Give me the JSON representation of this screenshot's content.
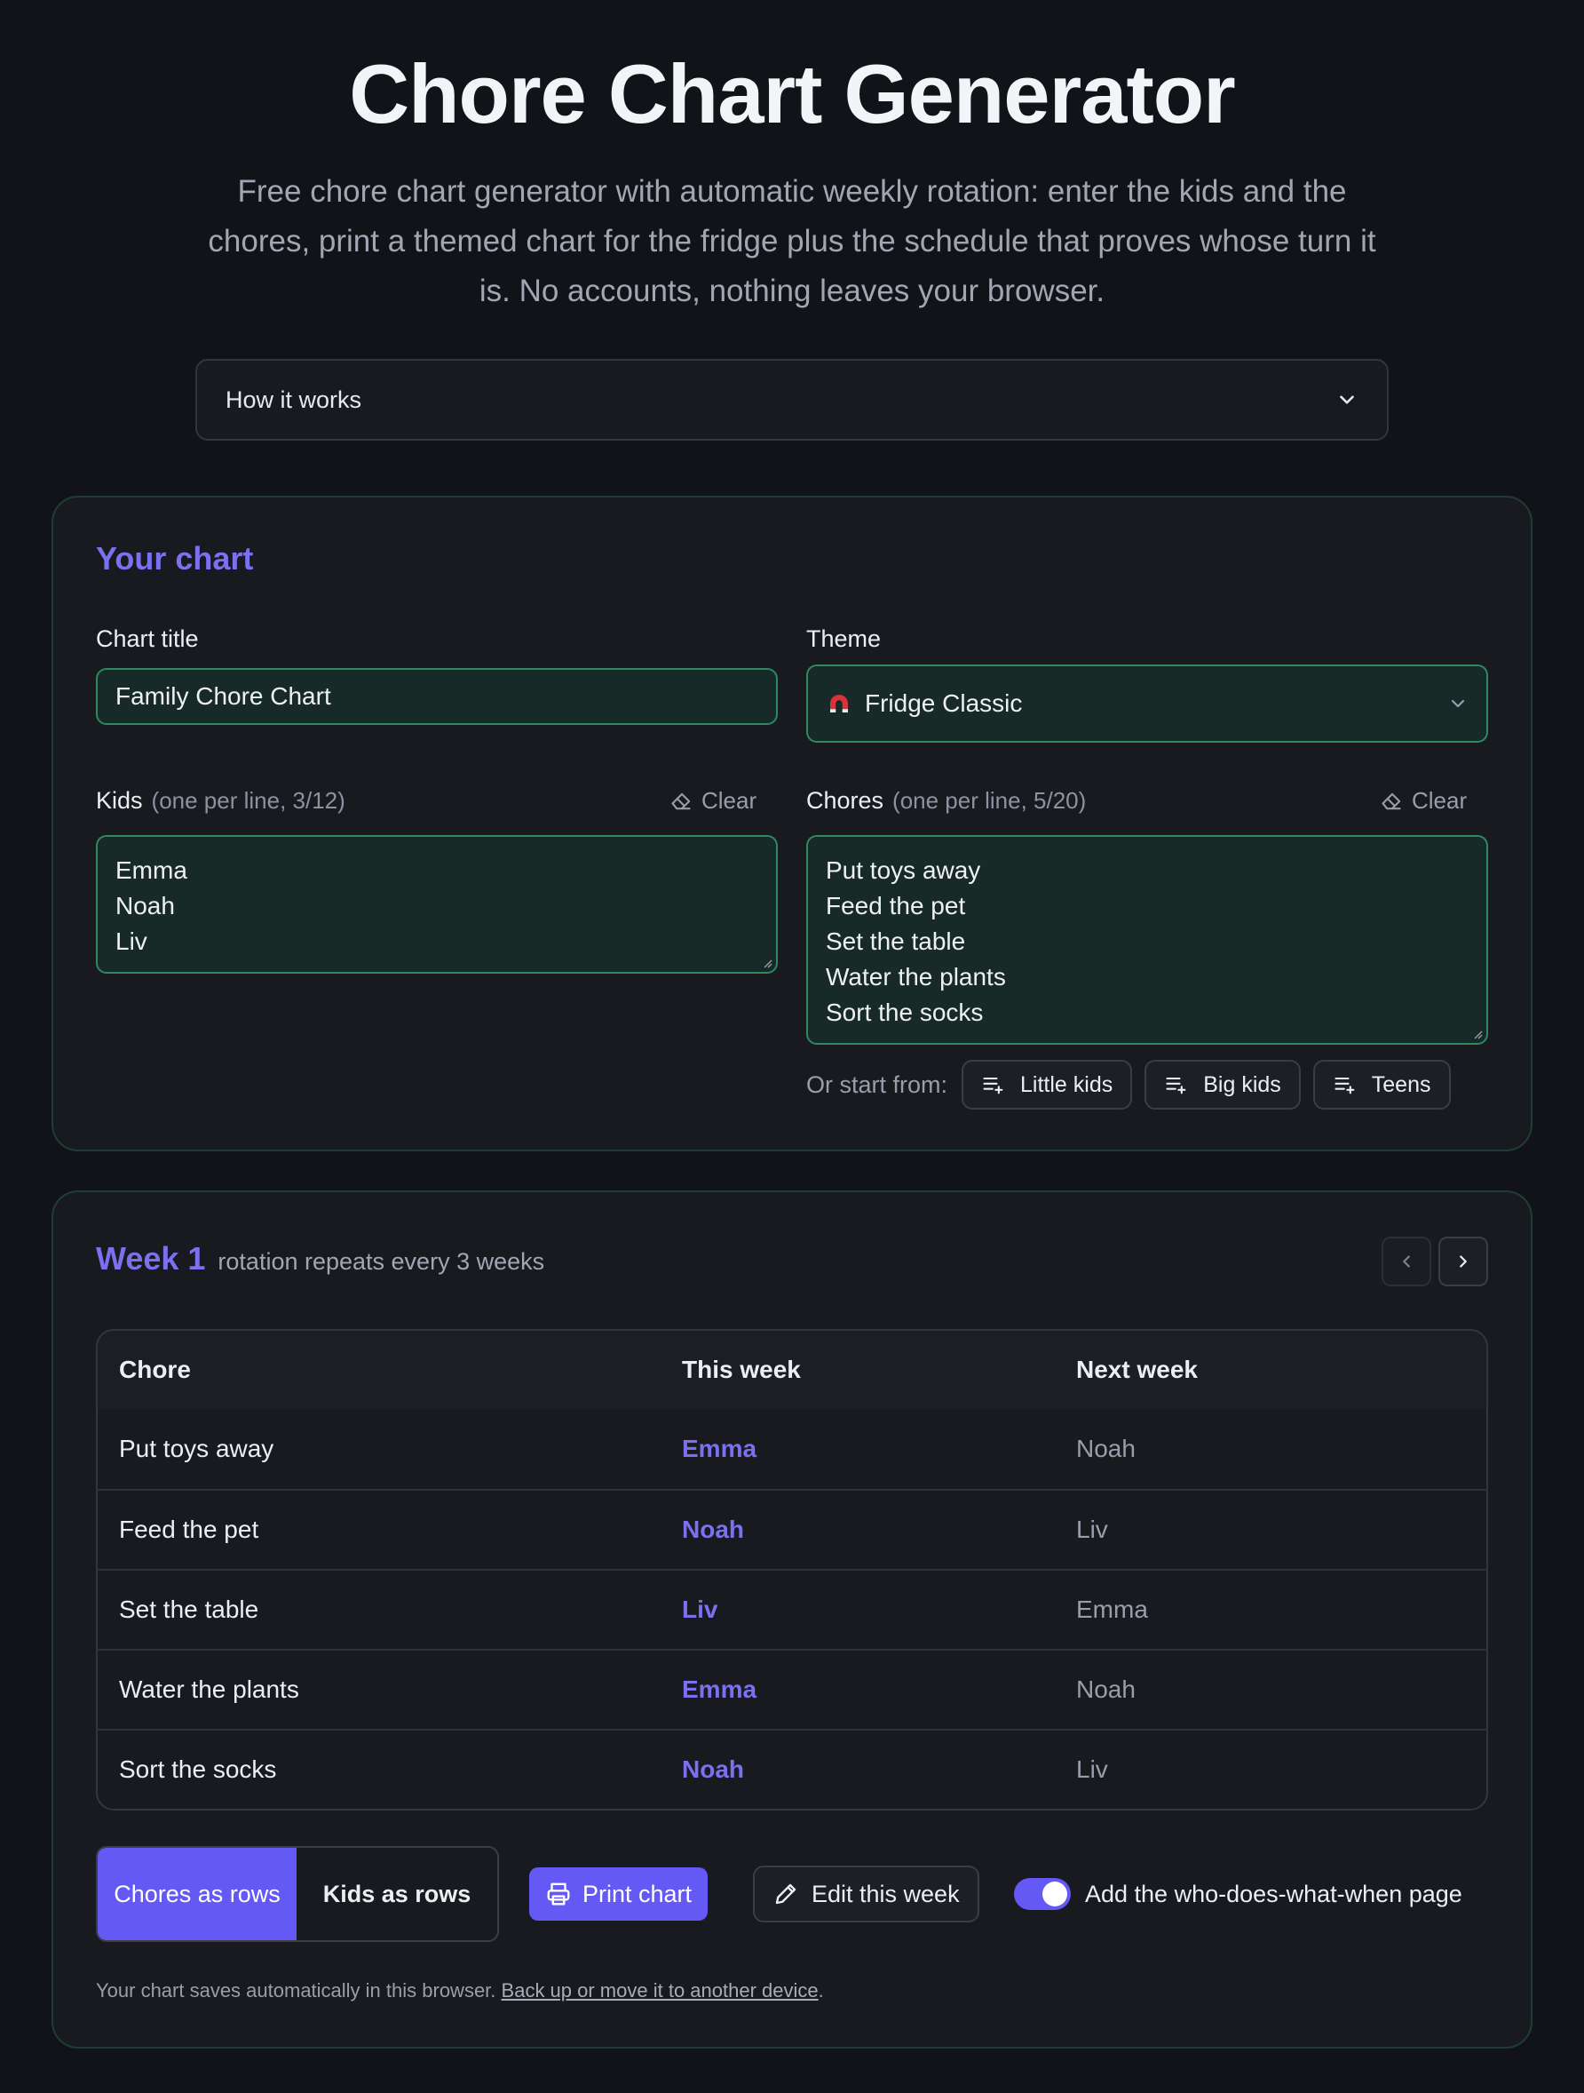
{
  "header": {
    "title": "Chore Chart Generator",
    "subtitle": "Free chore chart generator with automatic weekly rotation: enter the kids and the chores, print a themed chart for the fridge plus the schedule that proves whose turn it is. No accounts, nothing leaves your browser."
  },
  "how_it_works": {
    "label": "How it works",
    "icon": "chevron-down-icon"
  },
  "chart_form": {
    "heading": "Your chart",
    "title_label": "Chart title",
    "title_value": "Family Chore Chart",
    "theme_label": "Theme",
    "theme_value": "Fridge Classic",
    "theme_icon": "magnet-icon",
    "kids_label": "Kids",
    "kids_hint": "(one per line, 3/12)",
    "kids": [
      "Emma",
      "Noah",
      "Liv"
    ],
    "chores_label": "Chores",
    "chores_hint": "(one per line, 5/20)",
    "chores": [
      "Put toys away",
      "Feed the pet",
      "Set the table",
      "Water the plants",
      "Sort the socks"
    ],
    "clear_label": "Clear",
    "start_from_label": "Or start from:",
    "presets": [
      "Little kids",
      "Big kids",
      "Teens"
    ]
  },
  "week": {
    "title": "Week 1",
    "subtitle": "rotation repeats every 3 weeks",
    "columns": [
      "Chore",
      "This week",
      "Next week"
    ],
    "rows": [
      [
        "Put toys away",
        "Emma",
        "Noah"
      ],
      [
        "Feed the pet",
        "Noah",
        "Liv"
      ],
      [
        "Set the table",
        "Liv",
        "Emma"
      ],
      [
        "Water the plants",
        "Emma",
        "Noah"
      ],
      [
        "Sort the socks",
        "Noah",
        "Liv"
      ]
    ],
    "layout_options": [
      "Chores as rows",
      "Kids as rows"
    ],
    "selected_layout": "Chores as rows",
    "print_label": "Print chart",
    "edit_label": "Edit this week",
    "toggle_on": true,
    "toggle_label": "Add the who-does-what-when page",
    "footer_text": "Your chart saves automatically in this browser.",
    "footer_link": "Back up or move it to another device",
    "footer_end": "."
  },
  "colors": {
    "background": "#121318",
    "card": "#181a20",
    "accent": "#6459f5",
    "accent_text": "#7b71f0",
    "field_bg": "#172a28",
    "field_border": "#2c8a60"
  }
}
